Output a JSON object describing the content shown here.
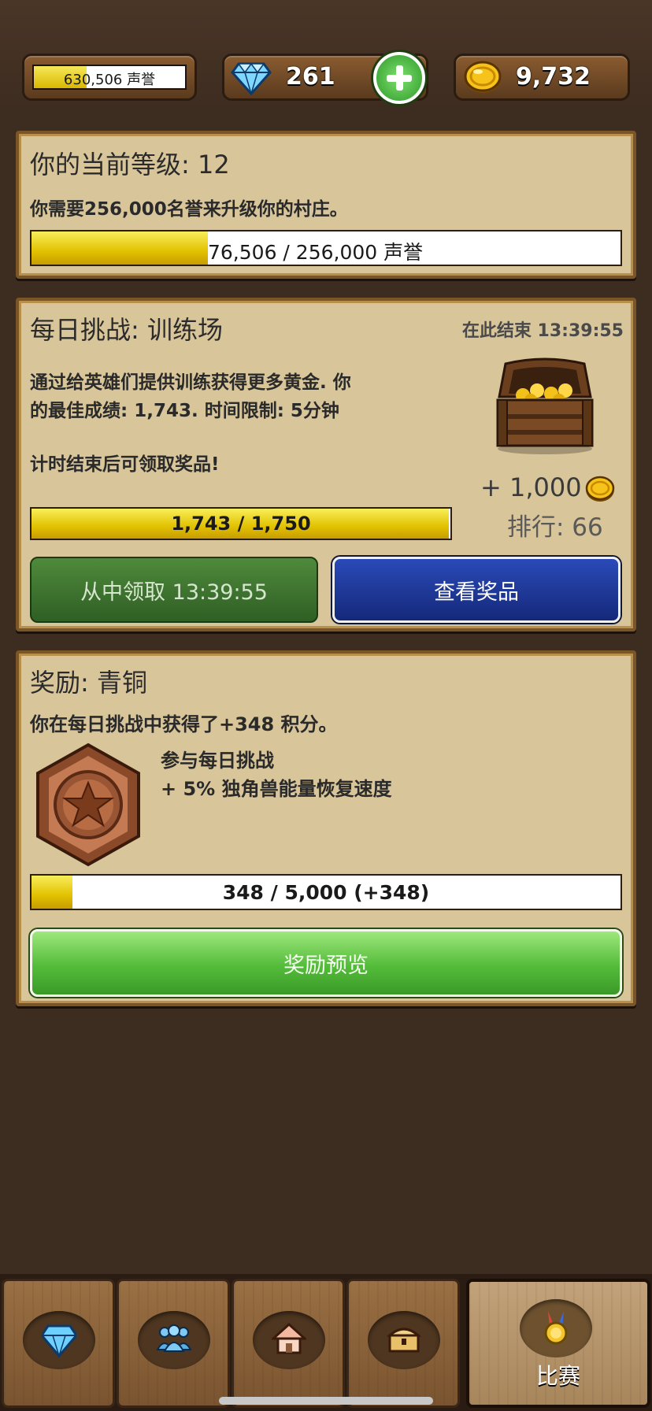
{
  "topbar": {
    "reputation_text": "630,506 声誉",
    "reputation_fill": 0.35,
    "gems": "261",
    "gold": "9,732"
  },
  "level_panel": {
    "title": "你的当前等级: 12",
    "description": "你需要256,000名誉来升级你的村庄。",
    "progress_text": "76,506 / 256,000 声誉",
    "progress_fraction": 0.3
  },
  "challenge_panel": {
    "title": "每日挑战: 训练场",
    "ends_at": "在此结束 13:39:55",
    "desc_line1": "通过给英雄们提供训练获得更多黄金. 你",
    "desc_line2": "的最佳成绩: 1,743. 时间限制: 5分钟",
    "desc_line3": "计时结束后可领取奖品!",
    "reward_amount": "+ 1,000",
    "rank": "排行: 66",
    "progress_text": "1,743 / 1,750",
    "progress_fraction": 0.996,
    "claim_label": "从中领取 13:39:55",
    "view_prizes_label": "查看奖品"
  },
  "reward_panel": {
    "title": "奖励: 青铜",
    "description": "你在每日挑战中获得了+348 积分。",
    "perk_line1": "参与每日挑战",
    "perk_line2": "+ 5% 独角兽能量恢复速度",
    "progress_text": "348 / 5,000 (+348)",
    "progress_fraction": 0.0696,
    "preview_label": "奖励预览"
  },
  "nav": {
    "items": [
      {
        "icon": "diamond-icon"
      },
      {
        "icon": "people-icon"
      },
      {
        "icon": "house-icon"
      },
      {
        "icon": "chest-icon"
      },
      {
        "icon": "medal-icon",
        "label": "比赛",
        "active": true
      }
    ]
  },
  "colors": {
    "background": "#3d2c20",
    "panel": "#d8c59a",
    "bar_fill": "#e2c100",
    "claim_green": "#2f5f24",
    "view_blue": "#15297a",
    "preview_green": "#54bc3a"
  }
}
